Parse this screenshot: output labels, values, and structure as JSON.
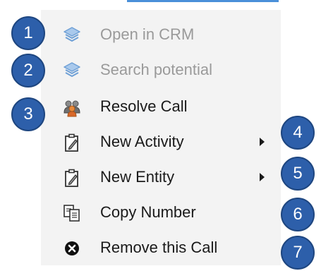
{
  "menu": {
    "items": [
      {
        "label": "Open in CRM",
        "icon": "layers-icon",
        "enabled": false,
        "submenu": false
      },
      {
        "label": "Search potential",
        "icon": "layers-icon",
        "enabled": false,
        "submenu": false
      },
      {
        "label": "Resolve Call",
        "icon": "people-group-icon",
        "enabled": true,
        "submenu": false
      },
      {
        "label": "New Activity",
        "icon": "clipboard-edit-icon",
        "enabled": true,
        "submenu": true
      },
      {
        "label": "New Entity",
        "icon": "clipboard-edit-icon",
        "enabled": true,
        "submenu": true
      },
      {
        "label": "Copy Number",
        "icon": "copy-icon",
        "enabled": true,
        "submenu": false
      },
      {
        "label": "Remove this Call",
        "icon": "close-circle-icon",
        "enabled": true,
        "submenu": false
      }
    ]
  },
  "callouts": [
    "1",
    "2",
    "3",
    "4",
    "5",
    "6",
    "7"
  ],
  "colors": {
    "menu_background": "#f3f3f3",
    "badge_fill": "#2d5faa",
    "disabled_text": "#9a9a9a",
    "accent": "#4a90d9"
  }
}
